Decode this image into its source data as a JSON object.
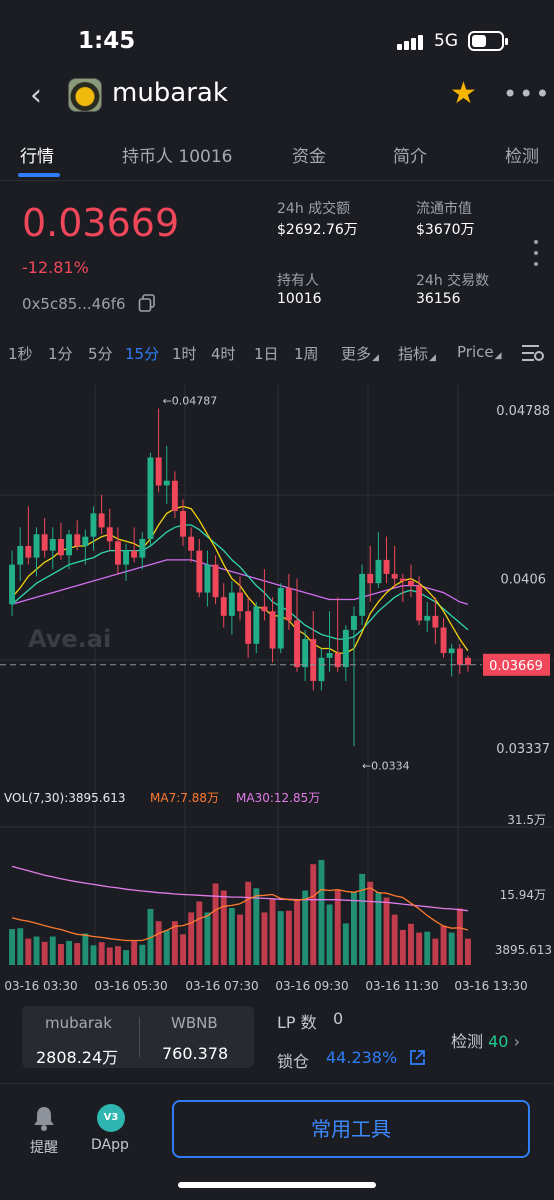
{
  "status_bar": {
    "time": "1:45",
    "network": "5G"
  },
  "header": {
    "token_name": "mubarak",
    "icons": [
      "back-icon",
      "token-logo",
      "star-icon",
      "more-icon"
    ]
  },
  "tabs": [
    {
      "label": "行情",
      "active": true
    },
    {
      "label": "持币人 10016"
    },
    {
      "label": "资金"
    },
    {
      "label": "简介"
    },
    {
      "label": "检测"
    }
  ],
  "summary": {
    "price": "0.03669",
    "change": "-12.81%",
    "address": "0x5c85...46f6",
    "stats": [
      {
        "label": "24h 成交额",
        "value": "$2692.76万"
      },
      {
        "label": "流通市值",
        "value": "$3670万"
      },
      {
        "label": "持有人",
        "value": "10016"
      },
      {
        "label": "24h 交易数",
        "value": "36156"
      }
    ]
  },
  "intervals": [
    {
      "label": "1秒"
    },
    {
      "label": "1分"
    },
    {
      "label": "5分"
    },
    {
      "label": "15分",
      "active": true
    },
    {
      "label": "1时"
    },
    {
      "label": "4时"
    },
    {
      "label": "1日"
    },
    {
      "label": "1周"
    },
    {
      "label": "更多"
    },
    {
      "label": "指标"
    },
    {
      "label": "Price"
    }
  ],
  "colors": {
    "up": "#22b08a",
    "down": "#f0475b",
    "accent": "#2f7df6",
    "ma7": "#f5d20e",
    "ma_mid": "#2fd6b0",
    "ma30": "#d26ff0",
    "vol_ma7": "#ff7a2f",
    "vol_ma30": "#e27be8"
  },
  "chart_data": {
    "type": "candlestick",
    "price_axis_labels": [
      "0.04788",
      "0.0406",
      "0.03337"
    ],
    "current_price_label": "0.03669",
    "high_marker": "←0.04787",
    "low_marker": "←0.0334",
    "watermark": "Ave.ai",
    "ylim": [
      0.03337,
      0.04788
    ],
    "x_tick_labels": [
      "03-16 03:30",
      "03-16 05:30",
      "03-16 07:30",
      "03-16 09:30",
      "03-16 11:30",
      "03-16 13:30"
    ],
    "candles": [
      {
        "o": 0.0395,
        "h": 0.0418,
        "l": 0.039,
        "c": 0.0412
      },
      {
        "o": 0.0412,
        "h": 0.0428,
        "l": 0.0405,
        "c": 0.042
      },
      {
        "o": 0.042,
        "h": 0.0437,
        "l": 0.0412,
        "c": 0.0415
      },
      {
        "o": 0.0415,
        "h": 0.0428,
        "l": 0.0407,
        "c": 0.0425
      },
      {
        "o": 0.0425,
        "h": 0.0432,
        "l": 0.0415,
        "c": 0.0418
      },
      {
        "o": 0.0418,
        "h": 0.0428,
        "l": 0.041,
        "c": 0.0423
      },
      {
        "o": 0.0423,
        "h": 0.043,
        "l": 0.0414,
        "c": 0.0416
      },
      {
        "o": 0.0416,
        "h": 0.0427,
        "l": 0.041,
        "c": 0.0425
      },
      {
        "o": 0.0425,
        "h": 0.0431,
        "l": 0.0418,
        "c": 0.042
      },
      {
        "o": 0.042,
        "h": 0.0427,
        "l": 0.0412,
        "c": 0.0424
      },
      {
        "o": 0.0424,
        "h": 0.0437,
        "l": 0.0418,
        "c": 0.0434
      },
      {
        "o": 0.0434,
        "h": 0.0442,
        "l": 0.0425,
        "c": 0.0428
      },
      {
        "o": 0.0428,
        "h": 0.0436,
        "l": 0.0418,
        "c": 0.0422
      },
      {
        "o": 0.0422,
        "h": 0.0428,
        "l": 0.0408,
        "c": 0.0412
      },
      {
        "o": 0.0412,
        "h": 0.0421,
        "l": 0.0405,
        "c": 0.0418
      },
      {
        "o": 0.0418,
        "h": 0.0428,
        "l": 0.0413,
        "c": 0.0415
      },
      {
        "o": 0.0415,
        "h": 0.0426,
        "l": 0.041,
        "c": 0.0423
      },
      {
        "o": 0.0423,
        "h": 0.046,
        "l": 0.042,
        "c": 0.0458
      },
      {
        "o": 0.0458,
        "h": 0.0479,
        "l": 0.0443,
        "c": 0.0446
      },
      {
        "o": 0.0446,
        "h": 0.0463,
        "l": 0.0438,
        "c": 0.0448
      },
      {
        "o": 0.0448,
        "h": 0.0452,
        "l": 0.0432,
        "c": 0.0435
      },
      {
        "o": 0.0435,
        "h": 0.044,
        "l": 0.042,
        "c": 0.0424
      },
      {
        "o": 0.0424,
        "h": 0.0428,
        "l": 0.0413,
        "c": 0.0418
      },
      {
        "o": 0.0418,
        "h": 0.0423,
        "l": 0.0398,
        "c": 0.04
      },
      {
        "o": 0.04,
        "h": 0.0418,
        "l": 0.0394,
        "c": 0.0412
      },
      {
        "o": 0.0412,
        "h": 0.0416,
        "l": 0.0395,
        "c": 0.0398
      },
      {
        "o": 0.0398,
        "h": 0.0404,
        "l": 0.0385,
        "c": 0.039
      },
      {
        "o": 0.039,
        "h": 0.0405,
        "l": 0.0382,
        "c": 0.04
      },
      {
        "o": 0.04,
        "h": 0.0407,
        "l": 0.0388,
        "c": 0.0392
      },
      {
        "o": 0.0392,
        "h": 0.0398,
        "l": 0.0372,
        "c": 0.0378
      },
      {
        "o": 0.0378,
        "h": 0.0396,
        "l": 0.0374,
        "c": 0.0394
      },
      {
        "o": 0.0394,
        "h": 0.041,
        "l": 0.0388,
        "c": 0.0392
      },
      {
        "o": 0.0392,
        "h": 0.0398,
        "l": 0.037,
        "c": 0.0376
      },
      {
        "o": 0.0376,
        "h": 0.0404,
        "l": 0.0374,
        "c": 0.0402
      },
      {
        "o": 0.0402,
        "h": 0.0408,
        "l": 0.0384,
        "c": 0.0388
      },
      {
        "o": 0.0388,
        "h": 0.0406,
        "l": 0.0366,
        "c": 0.0368
      },
      {
        "o": 0.0368,
        "h": 0.0384,
        "l": 0.0362,
        "c": 0.038
      },
      {
        "o": 0.038,
        "h": 0.0392,
        "l": 0.0358,
        "c": 0.0362
      },
      {
        "o": 0.0362,
        "h": 0.0376,
        "l": 0.0358,
        "c": 0.0372
      },
      {
        "o": 0.0372,
        "h": 0.0392,
        "l": 0.0366,
        "c": 0.0374
      },
      {
        "o": 0.0374,
        "h": 0.0398,
        "l": 0.0366,
        "c": 0.0368
      },
      {
        "o": 0.0368,
        "h": 0.0386,
        "l": 0.0362,
        "c": 0.0384
      },
      {
        "o": 0.0384,
        "h": 0.0394,
        "l": 0.0334,
        "c": 0.039
      },
      {
        "o": 0.039,
        "h": 0.0412,
        "l": 0.0386,
        "c": 0.0408
      },
      {
        "o": 0.0408,
        "h": 0.042,
        "l": 0.0396,
        "c": 0.0404
      },
      {
        "o": 0.0404,
        "h": 0.0426,
        "l": 0.0402,
        "c": 0.0414
      },
      {
        "o": 0.0414,
        "h": 0.0424,
        "l": 0.0404,
        "c": 0.0408
      },
      {
        "o": 0.0408,
        "h": 0.042,
        "l": 0.0402,
        "c": 0.0406
      },
      {
        "o": 0.0406,
        "h": 0.0408,
        "l": 0.0396,
        "c": 0.0405
      },
      {
        "o": 0.0405,
        "h": 0.0412,
        "l": 0.0398,
        "c": 0.0403
      },
      {
        "o": 0.0403,
        "h": 0.0407,
        "l": 0.0386,
        "c": 0.0388
      },
      {
        "o": 0.0388,
        "h": 0.0396,
        "l": 0.0383,
        "c": 0.039
      },
      {
        "o": 0.039,
        "h": 0.0398,
        "l": 0.0378,
        "c": 0.0385
      },
      {
        "o": 0.0385,
        "h": 0.0389,
        "l": 0.0372,
        "c": 0.0374
      },
      {
        "o": 0.0374,
        "h": 0.0378,
        "l": 0.0364,
        "c": 0.0376
      },
      {
        "o": 0.0376,
        "h": 0.0378,
        "l": 0.0365,
        "c": 0.0369
      },
      {
        "o": 0.0372,
        "h": 0.0373,
        "l": 0.0366,
        "c": 0.0369
      }
    ],
    "ma_lines": {
      "ma7": [
        0.0398,
        0.0402,
        0.0407,
        0.041,
        0.0413,
        0.0415,
        0.0418,
        0.0419,
        0.042,
        0.042,
        0.0422,
        0.0424,
        0.0425,
        0.0423,
        0.0422,
        0.0421,
        0.0419,
        0.0423,
        0.0429,
        0.0434,
        0.0436,
        0.0437,
        0.0436,
        0.0431,
        0.0425,
        0.0419,
        0.0412,
        0.0406,
        0.0403,
        0.0398,
        0.0394,
        0.0393,
        0.039,
        0.039,
        0.0388,
        0.0384,
        0.0382,
        0.0378,
        0.0376,
        0.0376,
        0.0374,
        0.0374,
        0.0376,
        0.0383,
        0.0391,
        0.0396,
        0.04,
        0.0403,
        0.0405,
        0.0406,
        0.0404,
        0.0401,
        0.0397,
        0.0392,
        0.0386,
        0.038,
        0.0375
      ],
      "ma25": [
        0.0395,
        0.0398,
        0.0401,
        0.0404,
        0.0406,
        0.0408,
        0.041,
        0.0412,
        0.0413,
        0.0414,
        0.0415,
        0.0417,
        0.0418,
        0.0418,
        0.0418,
        0.0418,
        0.0418,
        0.042,
        0.0423,
        0.0426,
        0.0428,
        0.0429,
        0.0429,
        0.0427,
        0.0424,
        0.0421,
        0.0418,
        0.0414,
        0.0411,
        0.0407,
        0.0403,
        0.04,
        0.0396,
        0.0394,
        0.0392,
        0.0389,
        0.0386,
        0.0384,
        0.0382,
        0.0381,
        0.038,
        0.038,
        0.0381,
        0.0384,
        0.0388,
        0.0392,
        0.0395,
        0.0398,
        0.04,
        0.0401,
        0.04,
        0.0398,
        0.0396,
        0.0393,
        0.039,
        0.0387,
        0.0384
      ],
      "ma99": [
        0.0395,
        0.0396,
        0.0397,
        0.0398,
        0.0399,
        0.04,
        0.0401,
        0.0402,
        0.0403,
        0.0404,
        0.0405,
        0.0406,
        0.0407,
        0.0408,
        0.0409,
        0.041,
        0.0411,
        0.0412,
        0.0413,
        0.0414,
        0.0414,
        0.0414,
        0.0414,
        0.0413,
        0.0412,
        0.0411,
        0.041,
        0.0409,
        0.0408,
        0.0407,
        0.0406,
        0.0405,
        0.0404,
        0.0403,
        0.0402,
        0.0401,
        0.04,
        0.0399,
        0.0398,
        0.0397,
        0.0397,
        0.0397,
        0.0397,
        0.0398,
        0.0399,
        0.04,
        0.0401,
        0.0402,
        0.0403,
        0.0403,
        0.0403,
        0.0402,
        0.0401,
        0.04,
        0.0398,
        0.0396,
        0.0395
      ]
    },
    "volume": {
      "header": "VOL(7,30):3895.613",
      "ma7_label": "MA7:7.88万",
      "ma30_label": "MA30:12.85万",
      "axis_labels": [
        "31.5万",
        "15.94万",
        "3895.613"
      ],
      "ylim": [
        0,
        31.5
      ],
      "values": [
        8.2,
        8.4,
        6.0,
        6.5,
        5.3,
        6.5,
        4.8,
        5.5,
        5.0,
        7.2,
        4.5,
        5.2,
        4.0,
        4.3,
        3.4,
        5.6,
        4.6,
        12.8,
        10.0,
        7.9,
        10.0,
        7.0,
        12.0,
        14.5,
        12.0,
        18.6,
        17.0,
        13.0,
        11.5,
        19.0,
        17.5,
        12.0,
        15.0,
        12.3,
        12.4,
        15.0,
        17.0,
        23.0,
        24.0,
        13.8,
        17.0,
        9.5,
        16.6,
        20.8,
        19.0,
        16.6,
        15.4,
        11.5,
        8.0,
        9.4,
        7.4,
        7.6,
        6.0,
        9.0,
        7.4,
        12.9,
        6.0
      ],
      "ma7": [
        10.8,
        10.3,
        10.0,
        9.5,
        9.0,
        8.5,
        8.1,
        7.5,
        7.0,
        6.8,
        6.5,
        6.3,
        6.0,
        5.8,
        5.6,
        5.6,
        5.6,
        6.2,
        7.2,
        7.9,
        8.8,
        9.0,
        9.6,
        10.6,
        11.2,
        12.6,
        13.4,
        13.6,
        14.0,
        15.0,
        15.8,
        15.9,
        16.1,
        15.2,
        14.9,
        14.8,
        15.0,
        15.7,
        17.2,
        17.0,
        17.2,
        16.8,
        16.6,
        17.1,
        17.6,
        16.5,
        16.4,
        15.8,
        15.4,
        14.1,
        12.8,
        11.3,
        10.0,
        8.9,
        8.4,
        8.5,
        8.0
      ],
      "ma30": [
        22.5,
        22.0,
        21.5,
        21.0,
        20.5,
        20.1,
        19.7,
        19.3,
        19.0,
        18.7,
        18.4,
        18.1,
        17.8,
        17.6,
        17.3,
        17.1,
        16.9,
        16.7,
        16.5,
        16.4,
        16.2,
        16.1,
        16.0,
        15.9,
        15.8,
        15.7,
        15.6,
        15.5,
        15.5,
        15.4,
        15.3,
        15.2,
        15.1,
        15.0,
        15.0,
        14.9,
        14.9,
        14.9,
        14.9,
        14.9,
        14.9,
        14.8,
        14.7,
        14.6,
        14.5,
        14.4,
        14.3,
        14.1,
        13.9,
        13.7,
        13.5,
        13.3,
        13.1,
        12.9,
        12.8,
        12.6,
        12.4
      ]
    }
  },
  "bottom": {
    "pair": [
      {
        "label": "mubarak",
        "value": "2808.24万"
      },
      {
        "label": "WBNB",
        "value": "760.378"
      }
    ],
    "lp_label": "LP 数",
    "lp_value": "0",
    "lock_label": "锁仓",
    "lock_value": "44.238%",
    "detect_label": "检测",
    "detect_value": "40",
    "nav": [
      {
        "label": "提醒"
      },
      {
        "label": "DApp"
      }
    ],
    "tool_button": "常用工具"
  }
}
